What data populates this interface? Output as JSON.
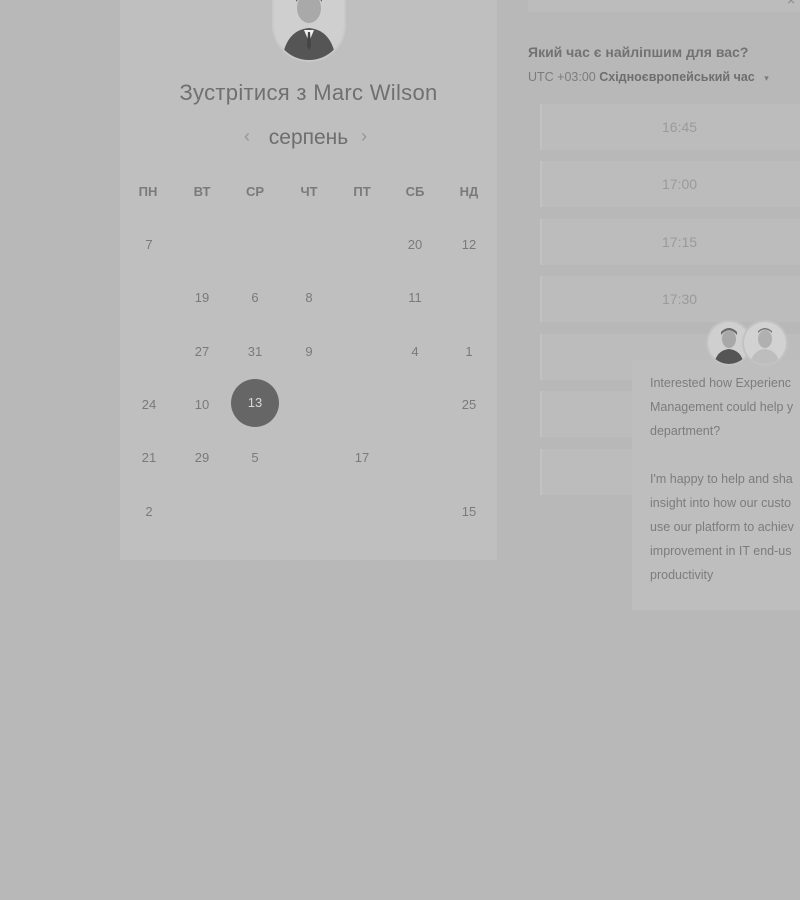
{
  "calendar": {
    "title": "Зустрітися з Marc Wilson",
    "month": "серпень",
    "prev_icon": "‹",
    "next_icon": "›",
    "weekdays": [
      "ПН",
      "ВТ",
      "СР",
      "ЧТ",
      "ПТ",
      "СБ",
      "НД"
    ],
    "selected_day": "13",
    "days": [
      [
        "7",
        "",
        "",
        "",
        "",
        "20",
        "12"
      ],
      [
        "",
        "19",
        "6",
        "8",
        "",
        "11",
        ""
      ],
      [
        "",
        "27",
        "31",
        "9",
        "",
        "4",
        "1"
      ],
      [
        "24",
        "10",
        "13",
        "",
        "",
        "",
        "25"
      ],
      [
        "21",
        "29",
        "5",
        "",
        "17",
        "",
        ""
      ],
      [
        "2",
        "",
        "",
        "",
        "",
        "",
        "15"
      ]
    ]
  },
  "time": {
    "question": "Який час є найліпшим для вас?",
    "tz_offset": "UTC +03:00",
    "tz_name": "Східноєвропейський час",
    "tz_caret": "▾",
    "close_icon": "×",
    "slots": [
      "16:45",
      "17:00",
      "17:15",
      "17:30"
    ]
  },
  "chat": {
    "message_1": "Interested how Experienc\nManagement could help y\ndepartment?",
    "message_2": "I'm happy to help and sha\ninsight into how our custo\nuse our platform to achiev\nimprovement in IT end-us\nproductivity"
  },
  "icons": {
    "avatar": "person-avatar-icon"
  },
  "colors": {
    "overlay": "#b8b8b8",
    "selected_day": "#666666"
  }
}
